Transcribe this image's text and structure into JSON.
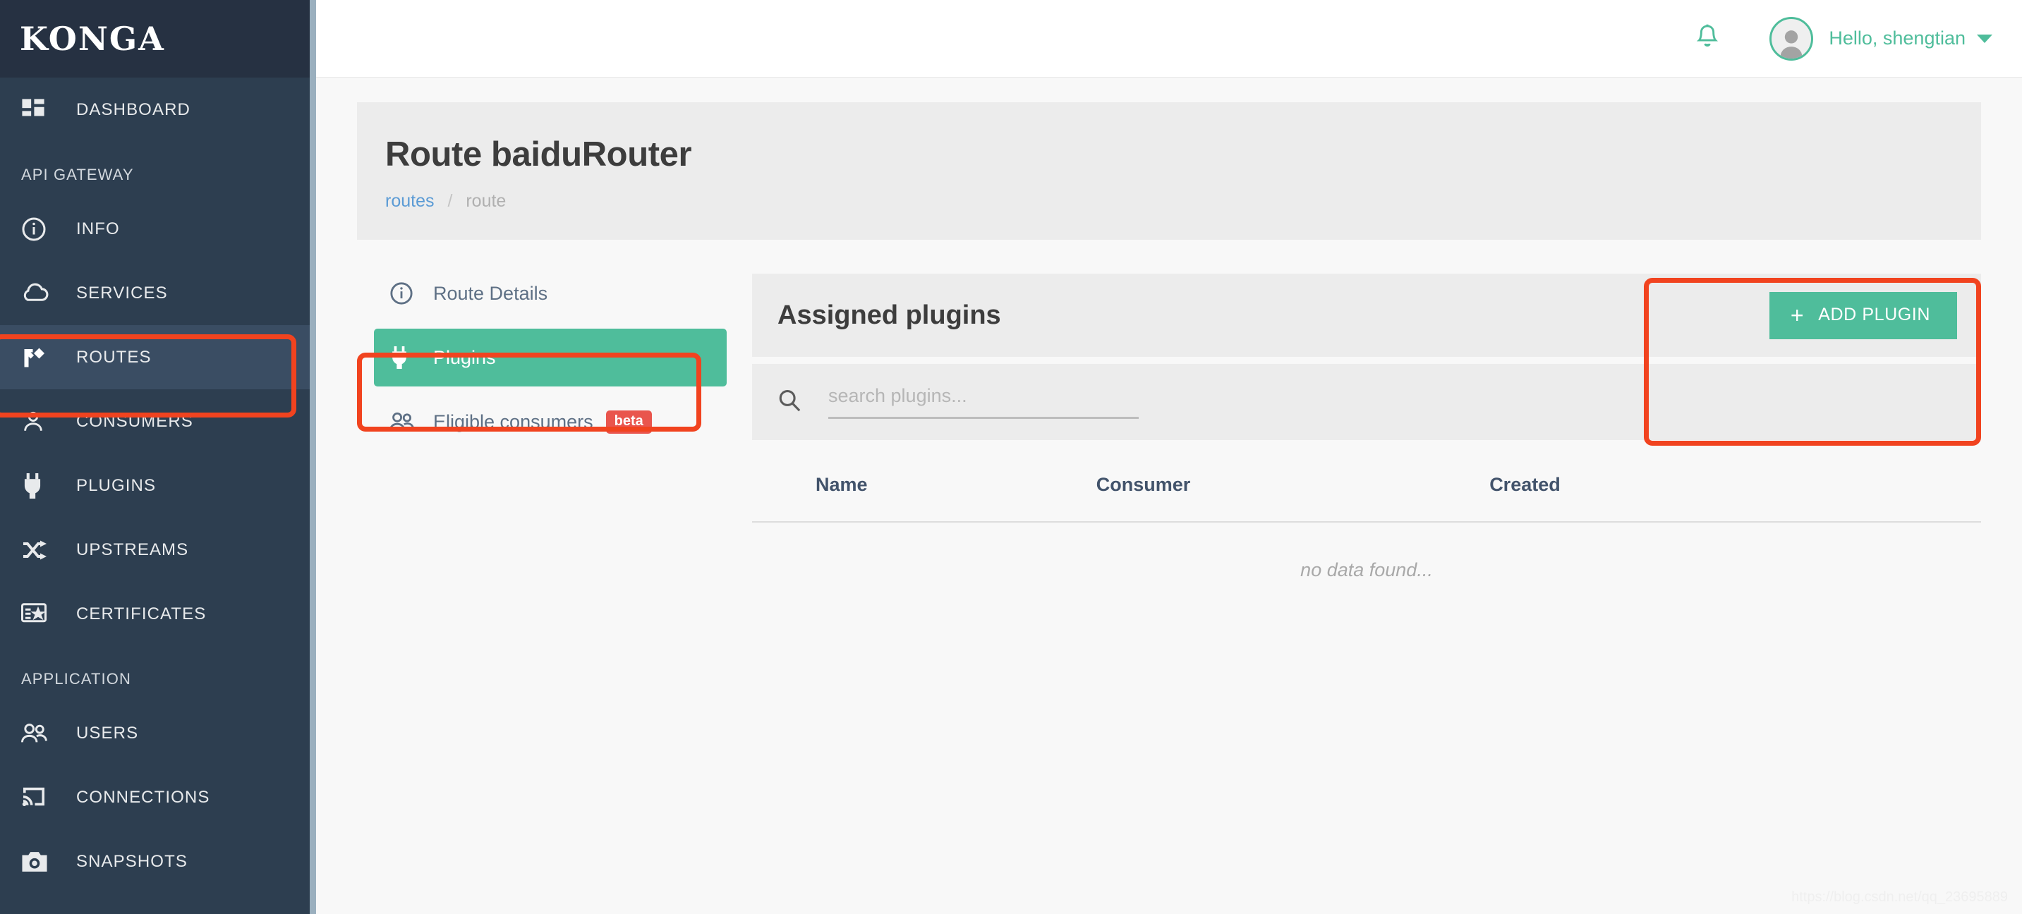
{
  "brand": {
    "logo": "KONGA",
    "accent": "#4fbd9b",
    "sidebar_bg": "#2d3e50",
    "annotation_color": "#f1431f"
  },
  "topbar": {
    "bell_icon": "bell-icon",
    "greeting": "Hello, shengtian",
    "avatar_icon": "user-avatar"
  },
  "sidebar": {
    "items": [
      {
        "label": "DASHBOARD",
        "icon": "dashboard-grid-icon",
        "active": false,
        "section": null
      },
      {
        "label": "API GATEWAY",
        "icon": null,
        "active": false,
        "section": true
      },
      {
        "label": "INFO",
        "icon": "info-circle-icon",
        "active": false,
        "section": null
      },
      {
        "label": "SERVICES",
        "icon": "cloud-icon",
        "active": false,
        "section": null
      },
      {
        "label": "ROUTES",
        "icon": "route-fork-icon",
        "active": true,
        "section": null
      },
      {
        "label": "CONSUMERS",
        "icon": "person-icon",
        "active": false,
        "section": null
      },
      {
        "label": "PLUGINS",
        "icon": "plug-icon",
        "active": false,
        "section": null
      },
      {
        "label": "UPSTREAMS",
        "icon": "shuffle-icon",
        "active": false,
        "section": null
      },
      {
        "label": "CERTIFICATES",
        "icon": "certificate-icon",
        "active": false,
        "section": null
      },
      {
        "label": "APPLICATION",
        "icon": null,
        "active": false,
        "section": true
      },
      {
        "label": "USERS",
        "icon": "people-icon",
        "active": false,
        "section": null
      },
      {
        "label": "CONNECTIONS",
        "icon": "cast-icon",
        "active": false,
        "section": null
      },
      {
        "label": "SNAPSHOTS",
        "icon": "camera-icon",
        "active": false,
        "section": null
      }
    ]
  },
  "page": {
    "title": "Route baiduRouter",
    "breadcrumb": {
      "parent": "routes",
      "separator": "/",
      "current": "route"
    }
  },
  "tabs": [
    {
      "label": "Route Details",
      "icon": "info-circle-icon",
      "active": false,
      "badge": null
    },
    {
      "label": "Plugins",
      "icon": "plug-icon",
      "active": true,
      "badge": null
    },
    {
      "label": "Eligible consumers",
      "icon": "people-icon",
      "active": false,
      "badge": "beta"
    }
  ],
  "panel": {
    "heading": "Assigned plugins",
    "add_button": {
      "label": "ADD PLUGIN",
      "icon": "plus-icon"
    },
    "search": {
      "placeholder": "search plugins...",
      "value": "",
      "icon": "search-icon"
    },
    "table": {
      "columns": [
        "Name",
        "Consumer",
        "Created"
      ],
      "rows": [],
      "empty_text": "no data found..."
    }
  },
  "watermark": "https://blog.csdn.net/qq_23695889"
}
